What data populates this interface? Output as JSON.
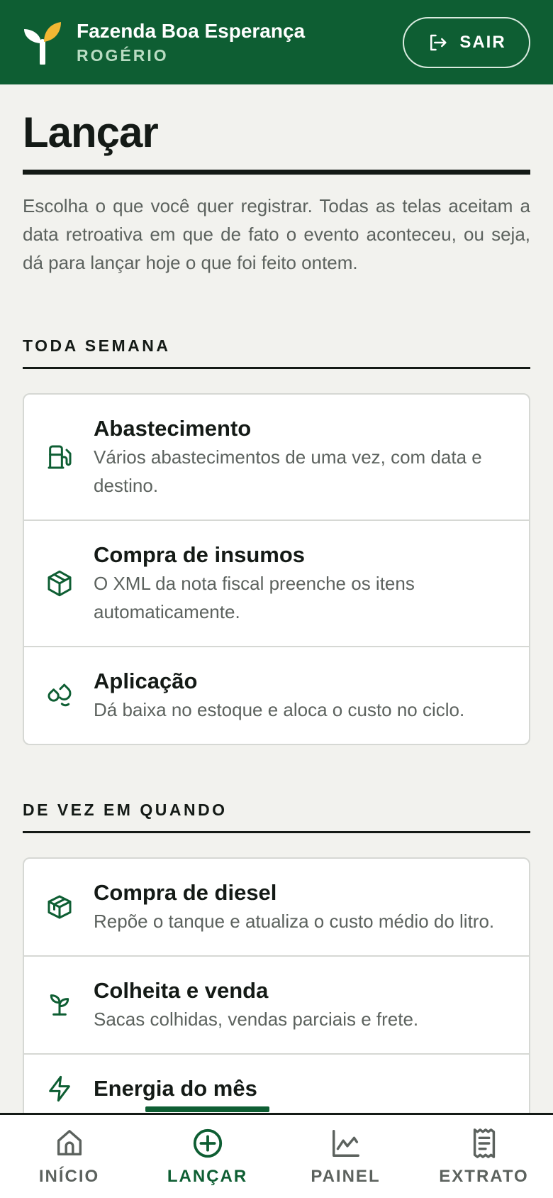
{
  "header": {
    "farm_name": "Fazenda Boa Esperança",
    "user_name": "ROGÉRIO",
    "logout_label": "SAIR",
    "brand_color": "#0e5e33"
  },
  "page": {
    "title": "Lançar",
    "intro": "Escolha o que você quer registrar. Todas as telas aceitam a data retroativa em que de fato o evento aconteceu, ou seja, dá para lançar hoje o que foi feito ontem."
  },
  "sections": [
    {
      "heading": "TODA SEMANA",
      "items": [
        {
          "icon": "fuel-pump-icon",
          "title": "Abastecimento",
          "desc": "Vários abastecimentos de uma vez, com data e destino."
        },
        {
          "icon": "box-icon",
          "title": "Compra de insumos",
          "desc": "O XML da nota fiscal preenche os itens automaticamente."
        },
        {
          "icon": "droplets-icon",
          "title": "Aplicação",
          "desc": "Dá baixa no estoque e aloca o custo no ciclo."
        }
      ]
    },
    {
      "heading": "DE VEZ EM QUANDO",
      "items": [
        {
          "icon": "package-icon",
          "title": "Compra de diesel",
          "desc": "Repõe o tanque e atualiza o custo médio do litro."
        },
        {
          "icon": "sprout-icon",
          "title": "Colheita e venda",
          "desc": "Sacas colhidas, vendas parciais e frete."
        },
        {
          "icon": "energy-icon",
          "title": "Energia do mês",
          "desc": ""
        }
      ]
    }
  ],
  "nav": {
    "items": [
      {
        "icon": "home-icon",
        "label": "INÍCIO"
      },
      {
        "icon": "plus-circle-icon",
        "label": "LANÇAR",
        "active": true
      },
      {
        "icon": "chart-icon",
        "label": "PAINEL"
      },
      {
        "icon": "receipt-icon",
        "label": "EXTRATO"
      }
    ]
  }
}
